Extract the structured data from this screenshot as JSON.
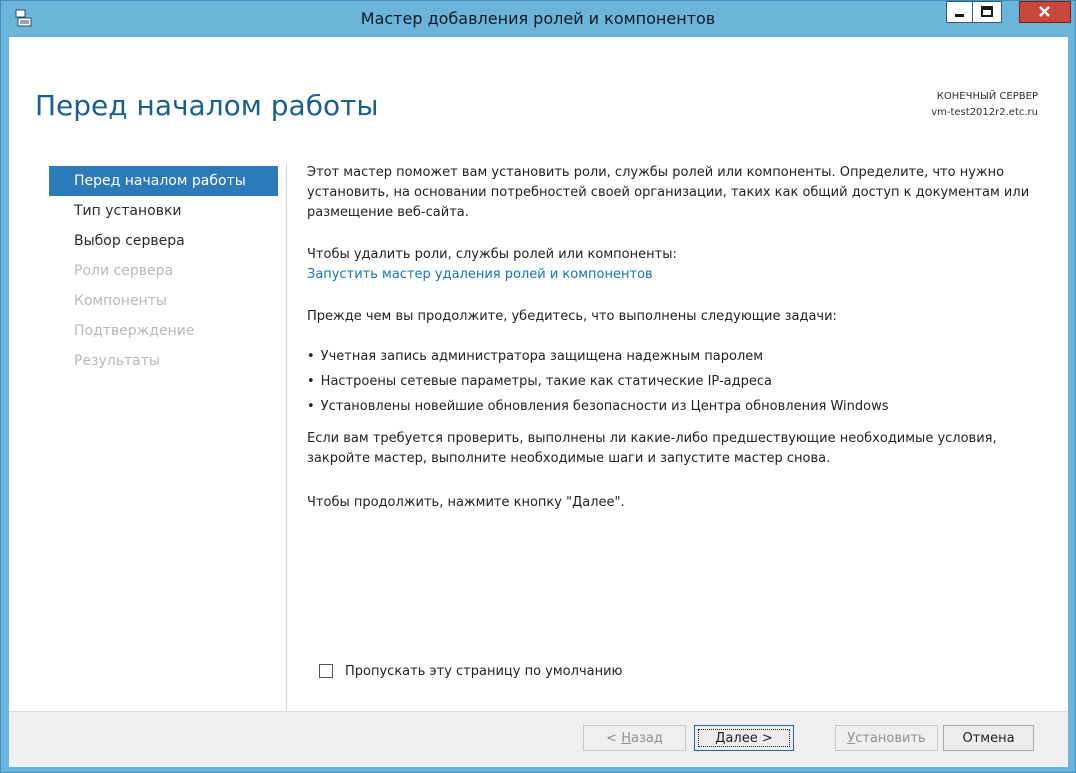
{
  "window": {
    "title": "Мастер добавления ролей и компонентов",
    "title_bar_color": "#6cb4da",
    "close_button_color": "#c7473a"
  },
  "page": {
    "title": "Перед началом работы",
    "target_server_label": "КОНЕЧНЫЙ СЕРВЕР",
    "target_server_name": "vm-test2012r2.etc.ru"
  },
  "nav": {
    "items": [
      {
        "label": "Перед началом работы",
        "state": "active"
      },
      {
        "label": "Тип установки",
        "state": "enabled"
      },
      {
        "label": "Выбор сервера",
        "state": "enabled"
      },
      {
        "label": "Роли сервера",
        "state": "disabled"
      },
      {
        "label": "Компоненты",
        "state": "disabled"
      },
      {
        "label": "Подтверждение",
        "state": "disabled"
      },
      {
        "label": "Результаты",
        "state": "disabled"
      }
    ]
  },
  "content": {
    "intro": "Этот мастер поможет вам установить роли, службы ролей или компоненты. Определите, что нужно установить, на основании потребностей своей организации, таких как общий доступ к документам или размещение веб-сайта.",
    "remove_text": "Чтобы удалить роли, службы ролей или компоненты:",
    "remove_link": "Запустить мастер удаления ролей и компонентов",
    "before_text": "Прежде чем вы продолжите, убедитесь, что выполнены следующие задачи:",
    "bullets": [
      "Учетная запись администратора защищена надежным паролем",
      "Настроены сетевые параметры, такие как статические IP-адреса",
      "Установлены новейшие обновления безопасности из Центра обновления Windows"
    ],
    "prereq_text": "Если вам требуется проверить, выполнены ли какие-либо предшествующие необходимые условия, закройте мастер, выполните необходимые шаги и запустите мастер снова.",
    "continue_text": "Чтобы продолжить, нажмите кнопку \"Далее\".",
    "skip_label": "Пропускать эту страницу по умолчанию",
    "skip_checked": false
  },
  "footer": {
    "back": {
      "prefix": "< ",
      "hotkey": "Н",
      "rest": "азад",
      "enabled": false
    },
    "next": {
      "hotkey": "Д",
      "rest": "алее >",
      "enabled": true
    },
    "install": {
      "hotkey": "У",
      "rest": "становить",
      "enabled": false
    },
    "cancel": {
      "label": "Отмена",
      "enabled": true
    }
  }
}
